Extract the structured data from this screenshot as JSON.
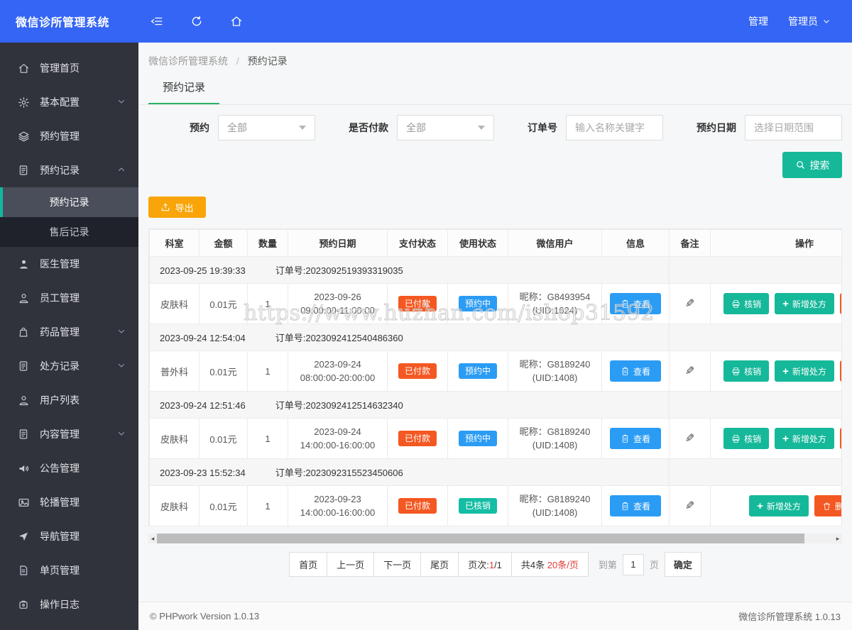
{
  "header": {
    "title": "微信诊所管理系统",
    "manage_link": "管理",
    "user_name": "管理员"
  },
  "sidebar": {
    "items": [
      {
        "label": "管理首页"
      },
      {
        "label": "基本配置"
      },
      {
        "label": "预约管理"
      },
      {
        "label": "预约记录"
      },
      {
        "label": "医生管理"
      },
      {
        "label": "员工管理"
      },
      {
        "label": "药品管理"
      },
      {
        "label": "处方记录"
      },
      {
        "label": "用户列表"
      },
      {
        "label": "内容管理"
      },
      {
        "label": "公告管理"
      },
      {
        "label": "轮播管理"
      },
      {
        "label": "导航管理"
      },
      {
        "label": "单页管理"
      },
      {
        "label": "操作日志"
      }
    ],
    "submenu": [
      {
        "label": "预约记录"
      },
      {
        "label": "售后记录"
      }
    ]
  },
  "breadcrumb": {
    "root": "微信诊所管理系统",
    "separator": "/",
    "current": "预约记录"
  },
  "tab": {
    "label": "预约记录"
  },
  "filters": {
    "appointment_label": "预约",
    "appointment_value": "全部",
    "paid_label": "是否付款",
    "paid_value": "全部",
    "order_label": "订单号",
    "order_placeholder": "输入名称关键字",
    "date_label": "预约日期",
    "date_placeholder": "选择日期范围",
    "search_label": "搜索"
  },
  "toolbar": {
    "export_label": "导出"
  },
  "table": {
    "columns": [
      "科室",
      "金额",
      "数量",
      "预约日期",
      "支付状态",
      "使用状态",
      "微信用户",
      "信息",
      "备注",
      "操作"
    ],
    "order_prefix": "订单号:",
    "view_label": "查看",
    "actions": {
      "verify": "核销",
      "prescribe": "新增处方",
      "delete": "删除"
    },
    "groups": [
      {
        "time": "2023-09-25 19:39:33",
        "order_no": "2023092519393319035",
        "row": {
          "dept": "皮肤科",
          "amount": "0.01元",
          "qty": "1",
          "date": "2023-09-26",
          "time_range": "09:00:00-11:00:00",
          "pay_status": "已付款",
          "use_status": "预约中",
          "nickname": "昵称：G8493954",
          "uid": "(UID:1624)"
        }
      },
      {
        "time": "2023-09-24 12:54:04",
        "order_no": "2023092412540486360",
        "row": {
          "dept": "普外科",
          "amount": "0.01元",
          "qty": "1",
          "date": "2023-09-24",
          "time_range": "08:00:00-20:00:00",
          "pay_status": "已付款",
          "use_status": "预约中",
          "nickname": "昵称：G8189240",
          "uid": "(UID:1408)"
        }
      },
      {
        "time": "2023-09-24 12:51:46",
        "order_no": "2023092412514632340",
        "row": {
          "dept": "皮肤科",
          "amount": "0.01元",
          "qty": "1",
          "date": "2023-09-24",
          "time_range": "14:00:00-16:00:00",
          "pay_status": "已付款",
          "use_status": "预约中",
          "nickname": "昵称：G8189240",
          "uid": "(UID:1408)"
        }
      },
      {
        "time": "2023-09-23 15:52:34",
        "order_no": "2023092315523450606",
        "row": {
          "dept": "皮肤科",
          "amount": "0.01元",
          "qty": "1",
          "date": "2023-09-23",
          "time_range": "14:00:00-16:00:00",
          "pay_status": "已付款",
          "use_status": "已核销",
          "nickname": "昵称：G8189240",
          "uid": "(UID:1408)"
        }
      }
    ]
  },
  "watermark": "https://www.huzhan.com/ishop31592",
  "pagination": {
    "first": "首页",
    "prev": "上一页",
    "next": "下一页",
    "last": "尾页",
    "page_label": "页次:",
    "page_current": "1",
    "page_total": "/1",
    "total_label": "共4条",
    "per_page": "20条/页",
    "goto_label": "到第",
    "goto_value": "1",
    "goto_unit": "页",
    "confirm": "确定"
  },
  "footer": {
    "left": "© PHPwork Version 1.0.13",
    "right": "微信诊所管理系统 1.0.13"
  },
  "colors": {
    "topbar_blue": "#3465f4",
    "teal": "#16b89a",
    "paid_badge": "#f45822",
    "reserved_badge": "#2b9cf4",
    "verified_badge": "#14bda4",
    "export_orange": "#f9a408",
    "tab_green": "#2bb169"
  }
}
